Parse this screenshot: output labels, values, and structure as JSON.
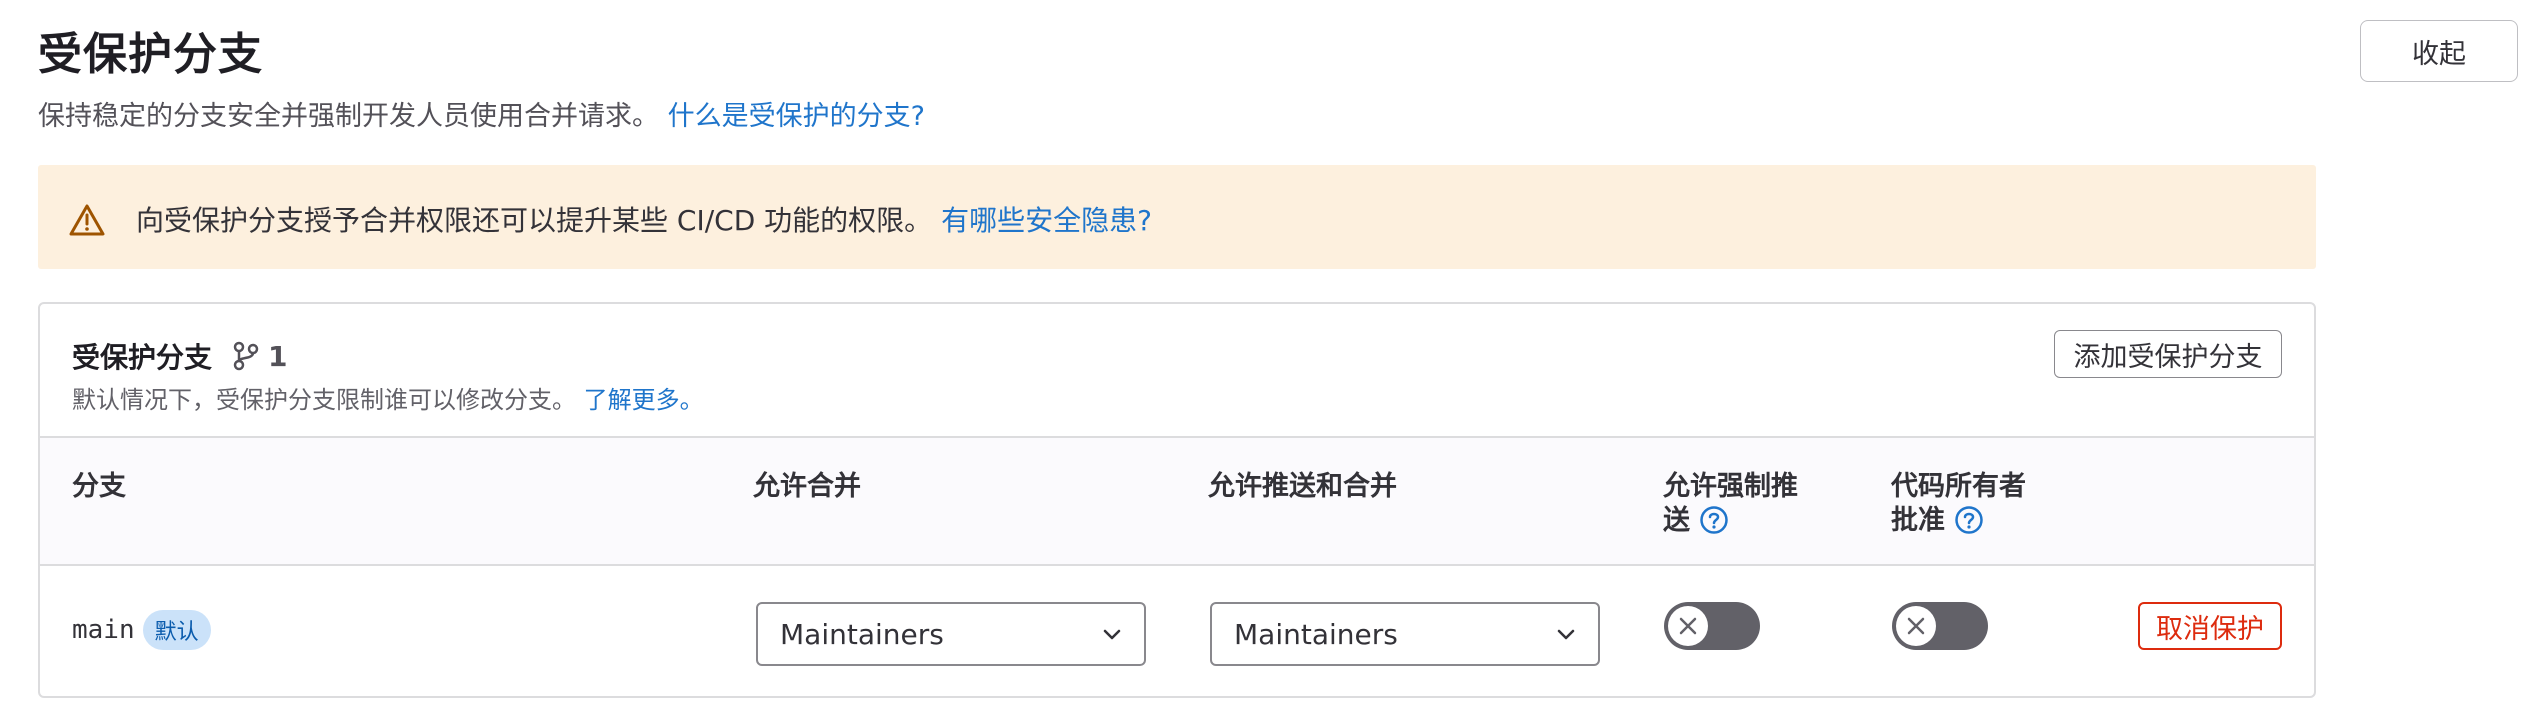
{
  "header": {
    "title": "受保护分支",
    "subtitle": "保持稳定的分支安全并强制开发人员使用合并请求。",
    "subtitle_link": "什么是受保护的分支?",
    "collapse_label": "收起"
  },
  "alert": {
    "icon": "warning-icon",
    "text": "向受保护分支授予合并权限还可以提升某些 CI/CD 功能的权限。",
    "link": "有哪些安全隐患?"
  },
  "card": {
    "title": "受保护分支",
    "branch_icon": "branch-icon",
    "count": "1",
    "description": "默认情况下，受保护分支限制谁可以修改分支。",
    "description_link": "了解更多。",
    "add_button": "添加受保护分支"
  },
  "table": {
    "columns": {
      "branch": "分支",
      "allowed_merge": "允许合并",
      "allowed_push_merge": "允许推送和合并",
      "force_push_line1": "允许强制推",
      "force_push_line2": "送",
      "code_owner_line1": "代码所有者",
      "code_owner_line2": "批准"
    },
    "rows": [
      {
        "branch": "main",
        "badge": "默认",
        "allowed_merge": "Maintainers",
        "allowed_push_merge": "Maintainers",
        "force_push": false,
        "code_owner_approval": false,
        "action": "取消保护"
      }
    ]
  },
  "colors": {
    "link": "#1f75cb",
    "warning_bg": "#fdf0de",
    "danger": "#dd2b0e",
    "toggle_off": "#626168"
  }
}
